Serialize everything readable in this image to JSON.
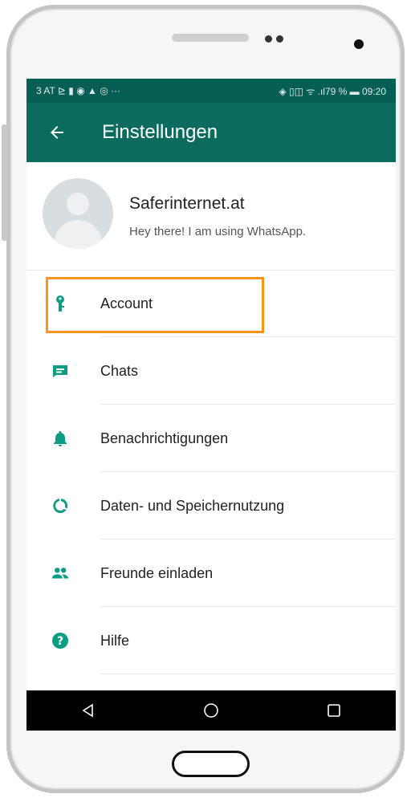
{
  "status_bar": {
    "left": "3 AT ⊵ ▮ ◉ ▲ ◎ ···",
    "right": "◈ ▯◫ ᯤ .ıl79 % ▬ 09:20"
  },
  "app_bar": {
    "title": "Einstellungen",
    "back_icon": "arrow-left-icon"
  },
  "profile": {
    "name": "Saferinternet.at",
    "status": "Hey there! I am using WhatsApp."
  },
  "menu": {
    "items": [
      {
        "label": "Account",
        "icon": "key-icon"
      },
      {
        "label": "Chats",
        "icon": "chat-icon"
      },
      {
        "label": "Benachrichtigungen",
        "icon": "bell-icon"
      },
      {
        "label": "Daten- und Speichernutzung",
        "icon": "data-usage-icon"
      },
      {
        "label": "Freunde einladen",
        "icon": "people-icon"
      },
      {
        "label": "Hilfe",
        "icon": "help-icon"
      }
    ]
  },
  "colors": {
    "accent": "#0a6b5e",
    "icon": "#0a9c84",
    "highlight": "#f7941d"
  }
}
